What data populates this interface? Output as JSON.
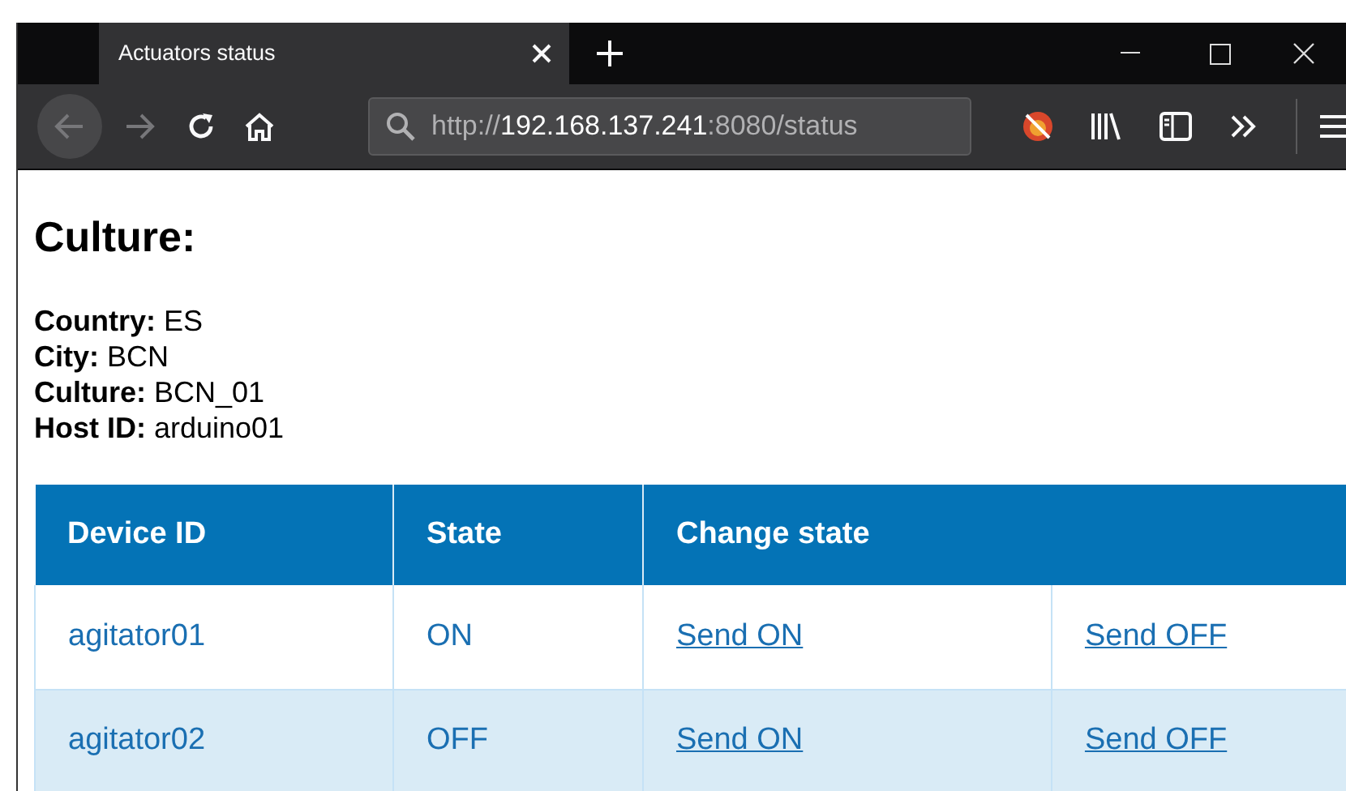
{
  "browser": {
    "tab_title": "Actuators status",
    "url_scheme": "http://",
    "url_host": "192.168.137.241",
    "url_rest": ":8080/status"
  },
  "page": {
    "heading": "Culture:",
    "info": [
      {
        "label": "Country:",
        "value": "ES"
      },
      {
        "label": "City:",
        "value": "BCN"
      },
      {
        "label": "Culture:",
        "value": "BCN_01"
      },
      {
        "label": "Host ID:",
        "value": "arduino01"
      }
    ],
    "table": {
      "columns": [
        "Device ID",
        "State",
        "Change state"
      ],
      "rows": [
        {
          "device_id": "agitator01",
          "state": "ON",
          "actions": [
            "Send ON",
            "Send OFF"
          ]
        },
        {
          "device_id": "agitator02",
          "state": "OFF",
          "actions": [
            "Send ON",
            "Send OFF"
          ]
        }
      ]
    }
  }
}
